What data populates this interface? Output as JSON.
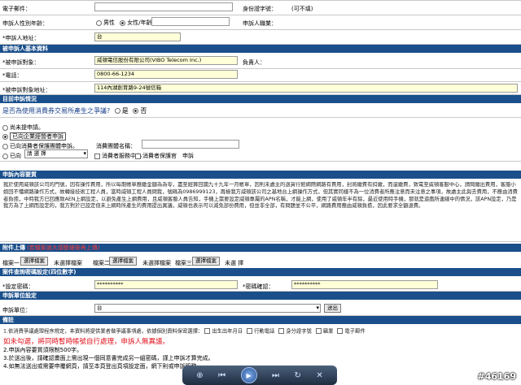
{
  "applicant": {
    "email_label": "電子郵件：",
    "id_label": "身份證字號：",
    "id_note": "(可不填)",
    "gender_age_label": "申訴人性別年齡：",
    "male": "男性",
    "female": "女性",
    "age": "/年齡",
    "job_label": "申訴人職業：",
    "address_label": "*申訴人地址：",
    "address_value": "台"
  },
  "respondent": {
    "section": "被申訴人基本資料",
    "name_label": "*被申訴對象：",
    "name_value": "威頓電信股份有限公司(VIBO Telecom Inc.)",
    "owner_label": "負責人：",
    "phone_label": "*電話：",
    "phone_value": "0800-66-1234",
    "address_label": "*被申訴對象地址：",
    "address_value": "114內湖創育路9-24號信箱"
  },
  "status": {
    "section": "目前申訴情況",
    "question": "是否為使用消費券交易所產生之爭議?",
    "yes": "是",
    "no": "否",
    "opt1": "尚未提申請。",
    "opt2": "已向企業經營者申訴",
    "opt3": "已向消費者保護團體申訴。",
    "org_label": "消費團體名稱：",
    "opt4": "已向",
    "opt4_sel": "請 選 擇",
    "chk1": "消費者服務中心",
    "chk2": "消費者保護官",
    "tail": "申訴"
  },
  "content": {
    "section": "申訴內容要質",
    "text": "我於使用威頓該公司的門號，因有操作費用，所以每期帳單應繳金額為為零，盡至經算回國九十九年一月帳單，因則未處主的退貨行館網際網路有費用，封將繳費有扣繳，而還繳費，致電至威頓客服中心，請問繳出費用，客服小姐回不懂網路操作方式，故轉接技術工程人員，當時威頓工程人員問我，號碼為0986999123，再檢我方威頓該公司之基地台上網操作方式，但其實同樣不為一位消費者所應注意而未注意之事項，故處主此與去費用，不應由消費者負擔，中時我方已回應致AEN上網設定，以避免產生上網費用，且威頓客服人員告知，手機上需要設定威頓專屬的APN名稱，才能上網，使用了威頓年半有餘，最近使用時手機，那就是遊戲所連線中的情況，該APN設定，乃是我方為了上網而設定的，我方對於已設定但未上網時所產生的費用提出異議，威頓也表示可以減免部份費用，但並非全部，有問題並不公平，網路費用應由威頓負擔，因此要求全額退費。"
  },
  "attach": {
    "section": "附件上傳",
    "note": "(若檔案過大請壓縮後再上傳)",
    "file1": "檔案一",
    "file2": "檔案二",
    "file3": "檔案三",
    "choose": "選擇檔案",
    "none": "未選擇檔案",
    "none3": "未選 擇"
  },
  "password": {
    "section": "案件查詢密碼設定(四位數字)",
    "set_label": "*設定密碼：",
    "set_value": "**********",
    "confirm_label": "*密碼確認：",
    "confirm_value": "**********"
  },
  "unit": {
    "section": "申訴單位設定",
    "label": "申訴單位：",
    "value": "台",
    "send": "送出"
  },
  "notes": {
    "section": "備註",
    "line1": "1.依消費爭議處理程序規定，本資料將提供業者做爭議事項處，依據個別資料保密選擇：",
    "opt_birth": "出生出年月日",
    "opt_phone": "行動電話",
    "opt_id": "身分證字號",
    "opt_job": "職業",
    "opt_email": "電子郵件",
    "red": "如未勾選，將同時暫時帳號自行處理，申訴人無異議。",
    "line2": "2.申訴內容要質須限制500字。",
    "line3": "3.於送出後，請確認畫面上需出現一個同意書完成另一組密碼，謹上申訴才算完成。",
    "line4": "4.如無法送出或需要申覆網頁，請至本頁登出頁項設定面，網下則或申訴服務。"
  },
  "watermark": "#46169"
}
